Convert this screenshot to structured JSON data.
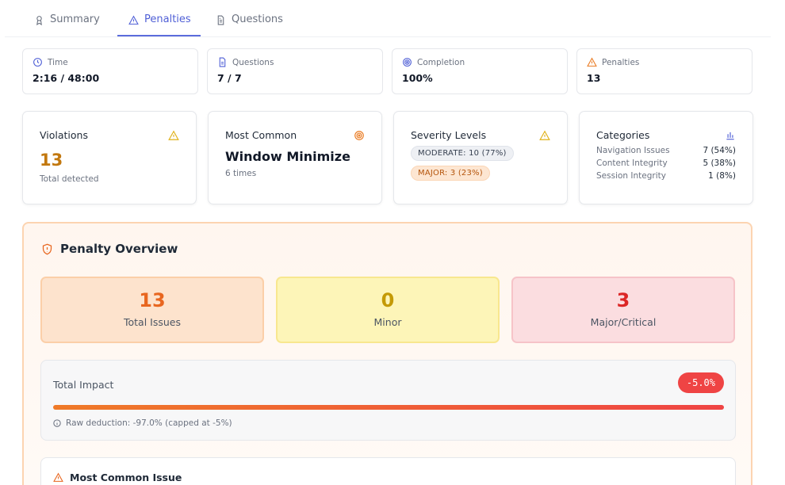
{
  "tabs": [
    {
      "label": "Summary",
      "icon": "award-icon"
    },
    {
      "label": "Penalties",
      "icon": "alert-triangle-icon",
      "active": true
    },
    {
      "label": "Questions",
      "icon": "file-text-icon"
    }
  ],
  "stats": {
    "time": {
      "label": "Time",
      "value": "2:16 / 48:00"
    },
    "questions": {
      "label": "Questions",
      "value": "7 / 7"
    },
    "completion": {
      "label": "Completion",
      "value": "100%"
    },
    "penalties": {
      "label": "Penalties",
      "value": "13"
    }
  },
  "violations": {
    "title": "Violations",
    "count": "13",
    "sub": "Total detected"
  },
  "most_common": {
    "title": "Most Common",
    "name": "Window Minimize",
    "sub": "6 times"
  },
  "severity": {
    "title": "Severity Levels",
    "moderate": "MODERATE: 10 (77%)",
    "major": "MAJOR: 3 (23%)"
  },
  "categories": {
    "title": "Categories",
    "rows": [
      {
        "name": "Navigation Issues",
        "value": "7 (54%)"
      },
      {
        "name": "Content Integrity",
        "value": "5 (38%)"
      },
      {
        "name": "Session Integrity",
        "value": "1 (8%)"
      }
    ]
  },
  "overview": {
    "title": "Penalty Overview",
    "total": {
      "value": "13",
      "label": "Total Issues"
    },
    "minor": {
      "value": "0",
      "label": "Minor"
    },
    "major": {
      "value": "3",
      "label": "Major/Critical"
    },
    "impact": {
      "label": "Total Impact",
      "badge": "-5.0%",
      "bar_fill": 1.0,
      "note": "Raw deduction: -97.0% (capped at -5%)"
    },
    "common_issue_title": "Most Common Issue"
  },
  "colors": {
    "accent": "#5b6cdc",
    "orange": "#e8661f",
    "red": "#ef4444",
    "amber": "#c2780f"
  }
}
